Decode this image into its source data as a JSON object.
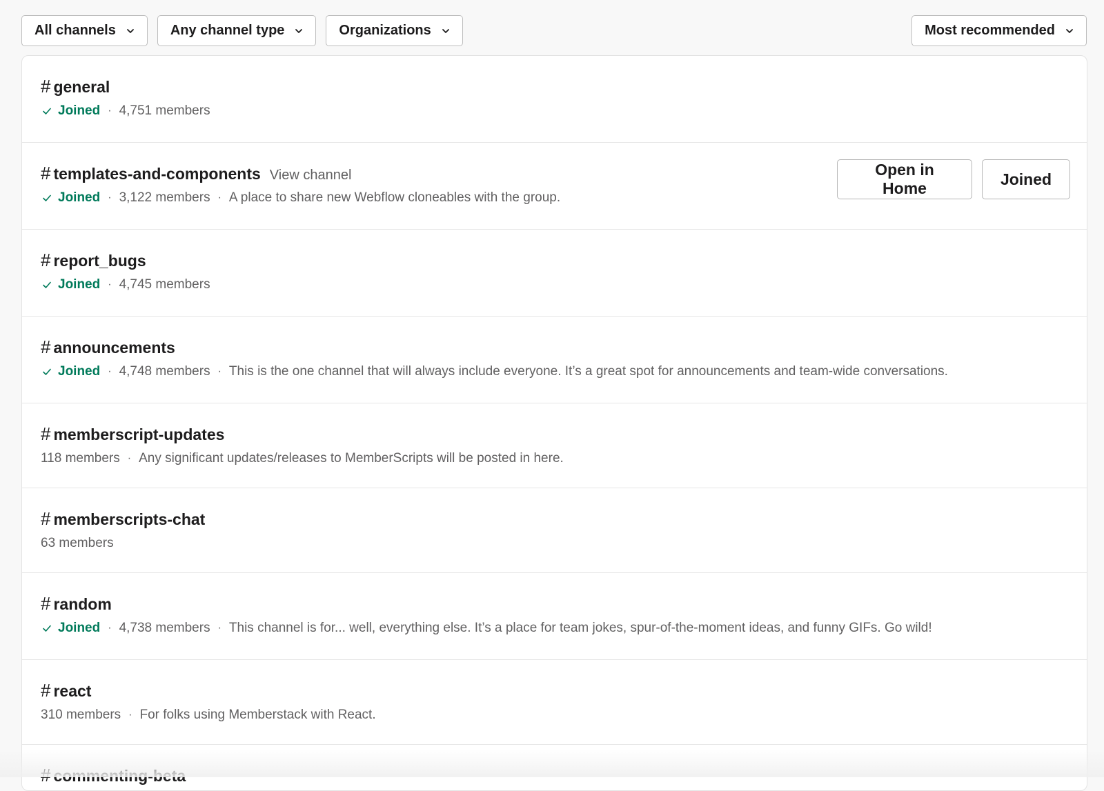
{
  "filters": {
    "channels": "All channels",
    "type": "Any channel type",
    "orgs": "Organizations",
    "sort": "Most recommended"
  },
  "separator": "·",
  "channels": [
    {
      "hash": "#",
      "name": "general",
      "joined": "Joined",
      "members": "4,751 members",
      "description": ""
    },
    {
      "hash": "#",
      "name": "templates-and-components",
      "view": "View channel",
      "joined": "Joined",
      "members": "3,122 members",
      "description": "A place to share new Webflow cloneables with the group.",
      "open_label": "Open in Home",
      "joined_button": "Joined"
    },
    {
      "hash": "#",
      "name": "report_bugs",
      "joined": "Joined",
      "members": "4,745 members",
      "description": ""
    },
    {
      "hash": "#",
      "name": "announcements",
      "joined": "Joined",
      "members": "4,748 members",
      "description": "This is the one channel that will always include everyone. It’s a great spot for announcements and team-wide conversations."
    },
    {
      "hash": "#",
      "name": "memberscript-updates",
      "members": "118 members",
      "description": "Any significant updates/releases to MemberScripts will be posted in here."
    },
    {
      "hash": "#",
      "name": "memberscripts-chat",
      "members": "63 members",
      "description": ""
    },
    {
      "hash": "#",
      "name": "random",
      "joined": "Joined",
      "members": "4,738 members",
      "description": "This channel is for... well, everything else. It’s a place for team jokes, spur-of-the-moment ideas, and funny GIFs. Go wild!"
    },
    {
      "hash": "#",
      "name": "react",
      "members": "310 members",
      "description": "For folks using Memberstack with React."
    },
    {
      "hash": "#",
      "name": "commenting-beta"
    }
  ],
  "colors": {
    "joined": "#007a5a",
    "muted": "#616061",
    "text": "#1d1c1d"
  },
  "icons": {
    "dropdown": "chevron-down-icon",
    "joined": "check-icon"
  }
}
